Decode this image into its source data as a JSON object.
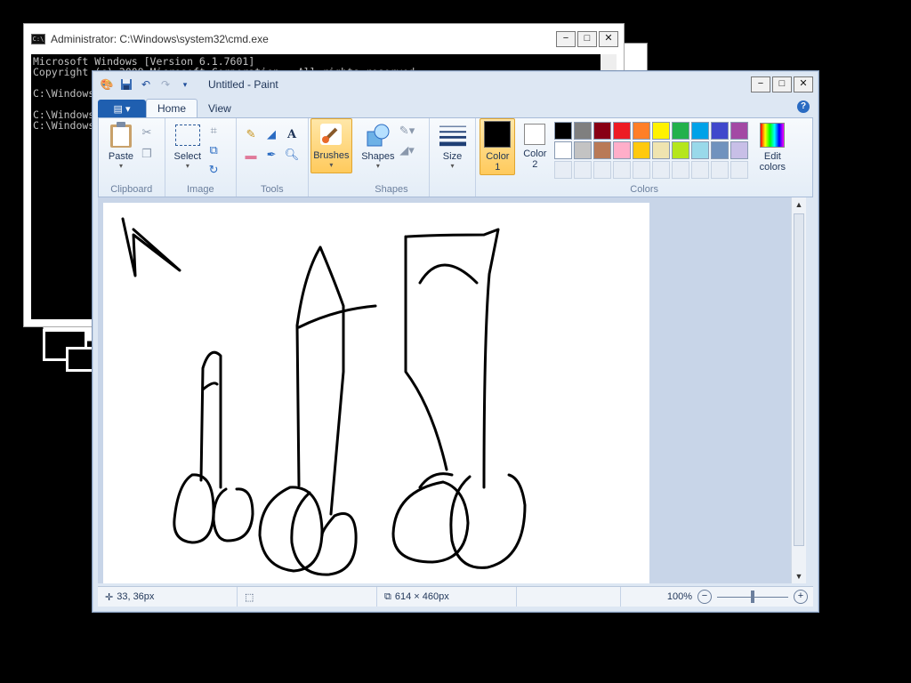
{
  "cmd": {
    "title": "Administrator: C:\\Windows\\system32\\cmd.exe",
    "lines": [
      "Microsoft Windows [Version 6.1.7601]",
      "Copyright (c) 2009 Microsoft Corporation.  All rights reserved.",
      "",
      "C:\\Windows",
      "",
      "C:\\Windows",
      "C:\\Windows"
    ]
  },
  "paint": {
    "title": "Untitled - Paint",
    "tabs": {
      "home": "Home",
      "view": "View"
    },
    "groups": {
      "clipboard": "Clipboard",
      "image": "Image",
      "tools": "Tools",
      "shapes": "Shapes",
      "colors": "Colors"
    },
    "buttons": {
      "paste": "Paste",
      "select": "Select",
      "brushes": "Brushes",
      "shapes": "Shapes",
      "size": "Size",
      "color1": "Color\n1",
      "color2": "Color\n2",
      "edit_colors": "Edit\ncolors"
    },
    "palette": [
      "#000000",
      "#7f7f7f",
      "#880015",
      "#ed1c24",
      "#ff7f27",
      "#fff200",
      "#22b14c",
      "#00a2e8",
      "#3f48cc",
      "#a349a4",
      "#ffffff",
      "#c3c3c3",
      "#b97a57",
      "#ffaec9",
      "#ffc90e",
      "#efe4b0",
      "#b5e61d",
      "#99d9ea",
      "#7092be",
      "#c8bfe7"
    ],
    "color1_value": "#000000",
    "color2_value": "#ffffff",
    "status": {
      "cursor": "33, 36px",
      "size": "614 × 460px",
      "zoom": "100%"
    }
  }
}
